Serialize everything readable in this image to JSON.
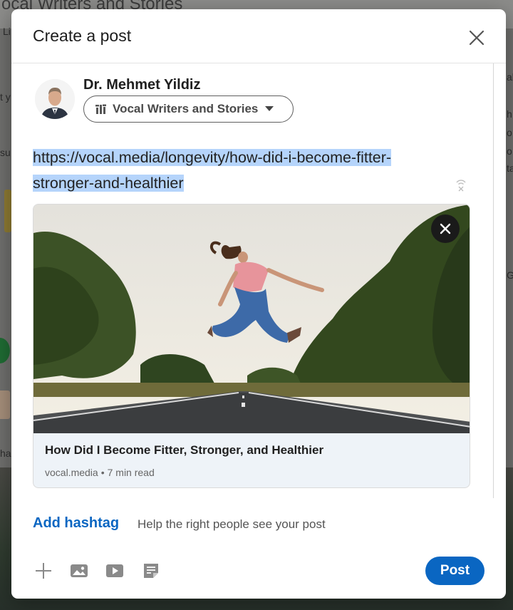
{
  "background": {
    "title": "ocal Writers and Stories",
    "snippets": [
      "Li",
      "t y",
      "su",
      "ha",
      "ab",
      "h",
      "o",
      "o",
      "ta",
      "Gr"
    ]
  },
  "modal": {
    "title": "Create a post",
    "close_icon": "close-icon"
  },
  "author": {
    "name": "Dr. Mehmet Yildiz",
    "audience": "Vocal Writers and Stories",
    "audience_icon": "group-bars-icon"
  },
  "post": {
    "url_line1": "https://vocal.media/longevity/how-did-i-become-fitter-",
    "url_line2": "stronger-and-healthier"
  },
  "preview": {
    "title": "How Did I Become Fitter, Stronger, and Healthier",
    "source": "vocal.media",
    "separator": "•",
    "read_time": "7 min read"
  },
  "hashtag": {
    "add_label": "Add hashtag",
    "help": "Help the right people see your post"
  },
  "toolbar": {
    "post_label": "Post",
    "icons": [
      "plus-icon",
      "photo-icon",
      "video-icon",
      "document-icon"
    ]
  },
  "colors": {
    "accent": "#0a66c2",
    "selection": "#b5d4fb"
  }
}
